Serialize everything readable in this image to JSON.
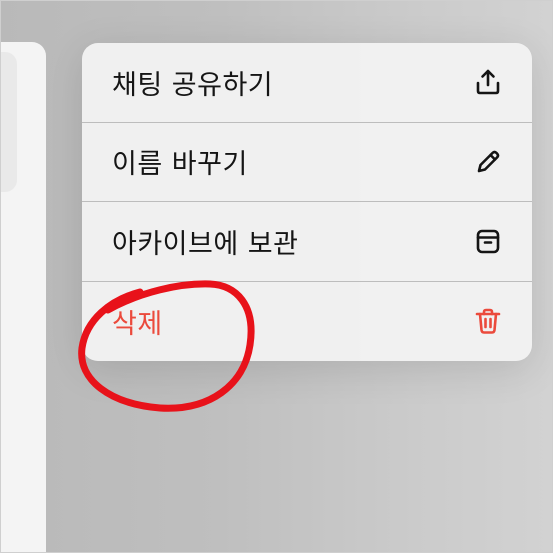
{
  "menu": {
    "items": [
      {
        "label": "채팅 공유하기",
        "icon": "share-icon",
        "destructive": false
      },
      {
        "label": "이름 바꾸기",
        "icon": "pencil-icon",
        "destructive": false
      },
      {
        "label": "아카이브에 보관",
        "icon": "archive-icon",
        "destructive": false
      },
      {
        "label": "삭제",
        "icon": "trash-icon",
        "destructive": true
      }
    ]
  },
  "colors": {
    "destructive": "#eb4a3c",
    "annotation": "#e8121a",
    "menu_background": "#f2f2f2",
    "backdrop": "#c4c4c4"
  }
}
